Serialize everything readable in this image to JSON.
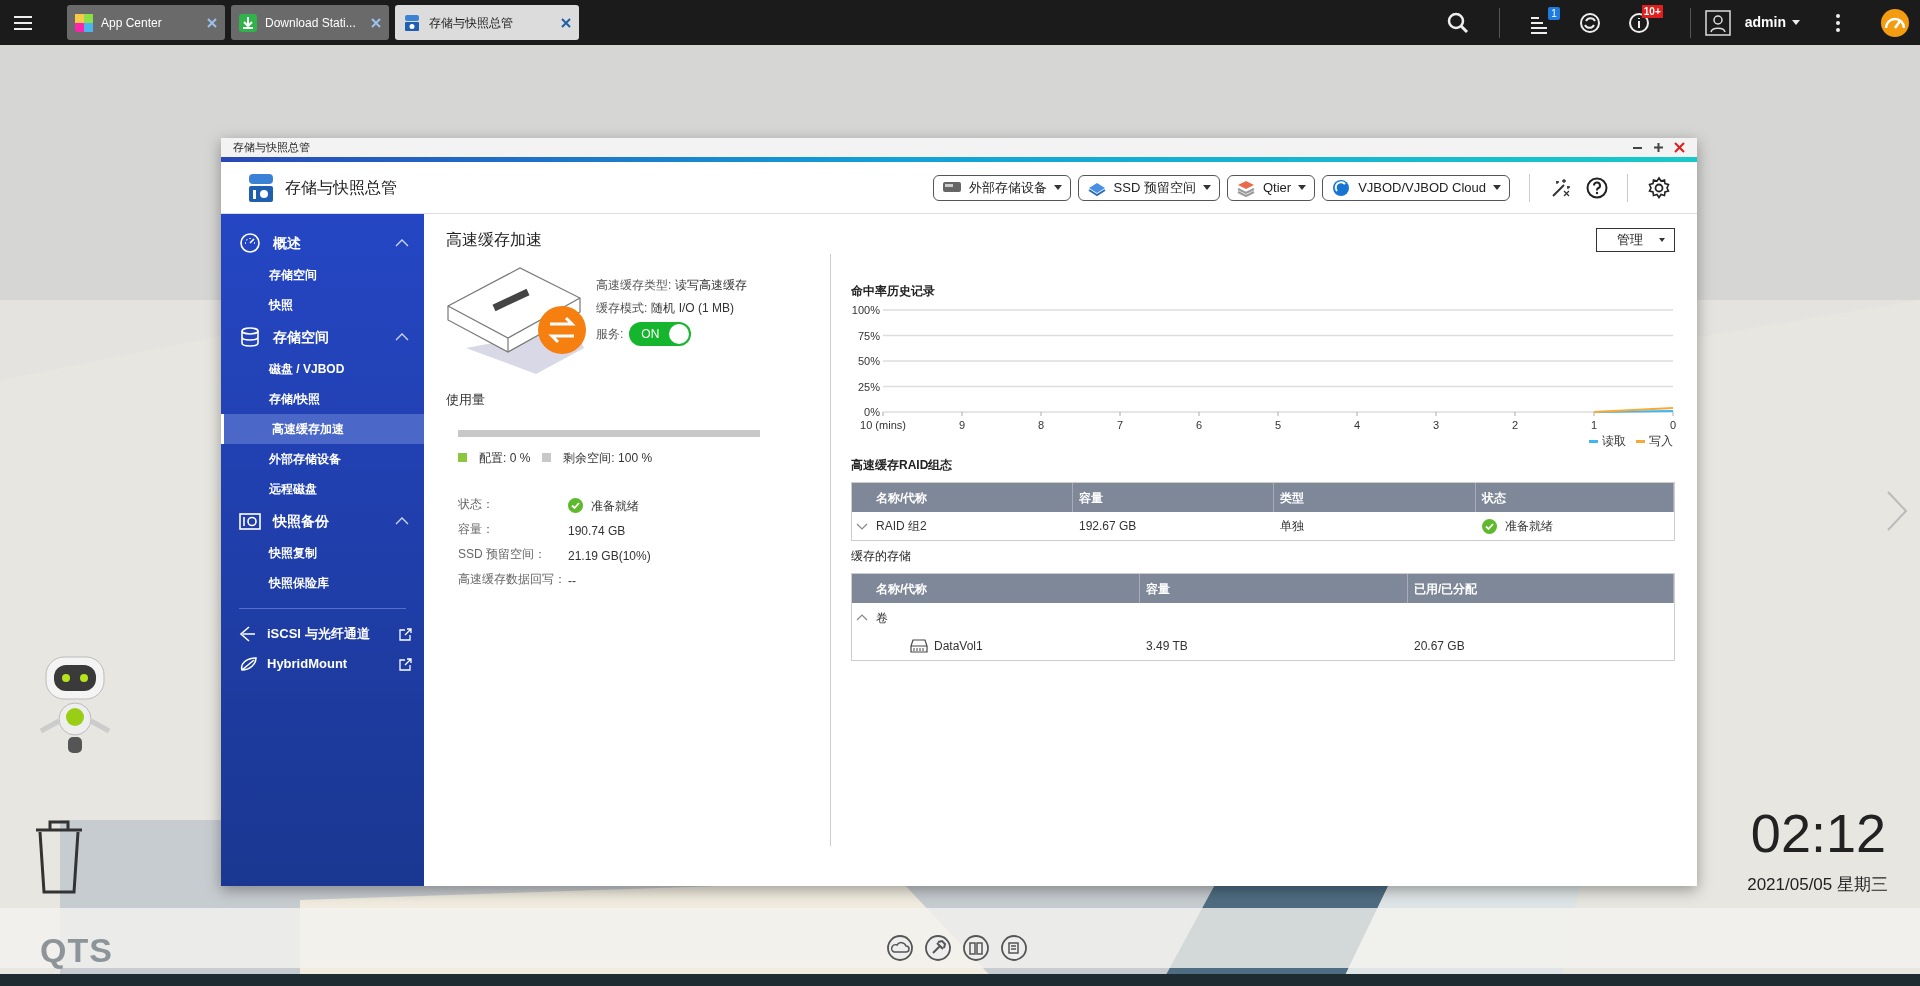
{
  "taskbar": {
    "tabs": [
      {
        "label": "App Center",
        "selected": false
      },
      {
        "label": "Download Stati...",
        "selected": false
      },
      {
        "label": "存储与快照总管",
        "selected": true
      }
    ],
    "badges": [
      "1",
      "10+"
    ],
    "user": "admin"
  },
  "window": {
    "title": "存储与快照总管",
    "app_name": "存储与快照总管",
    "toolbar_buttons": [
      "外部存储设备",
      "SSD 预留空间",
      "Qtier",
      "VJBOD/VJBOD Cloud"
    ]
  },
  "sidebar": {
    "sections": [
      {
        "label": "概述",
        "expanded": true,
        "children": [
          {
            "label": "存储空间",
            "selected": false
          },
          {
            "label": "快照",
            "selected": false
          }
        ]
      },
      {
        "label": "存储空间",
        "expanded": true,
        "children": [
          {
            "label": "磁盘 / VJBOD",
            "selected": false
          },
          {
            "label": "存储/快照",
            "selected": false
          },
          {
            "label": "高速缓存加速",
            "selected": true
          },
          {
            "label": "外部存储设备",
            "selected": false
          },
          {
            "label": "远程磁盘",
            "selected": false
          }
        ]
      },
      {
        "label": "快照备份",
        "expanded": true,
        "children": [
          {
            "label": "快照复制",
            "selected": false
          },
          {
            "label": "快照保险库",
            "selected": false
          }
        ]
      }
    ],
    "links": [
      "iSCSI 与光纤通道",
      "HybridMount"
    ]
  },
  "page": {
    "title": "高速缓存加速",
    "manage_button": "管理",
    "cache": {
      "fields": [
        {
          "label": "高速缓存类型:",
          "value": "读写高速缓存"
        },
        {
          "label": "缓存模式:",
          "value": "随机 I/O (1 MB)"
        }
      ],
      "service": {
        "label": "服务:",
        "on": true,
        "text": "ON"
      }
    },
    "usage": {
      "title": "使用量",
      "level": 0,
      "legend": [
        {
          "label": "配置: 0 %",
          "color": "#8cc63f"
        },
        {
          "label": "剩余空间: 100 %",
          "color": "#c8c8c8"
        }
      ]
    },
    "details": [
      {
        "label": "状态：",
        "value": "准备就绪",
        "kind": "status"
      },
      {
        "label": "容量：",
        "value": "190.74 GB",
        "kind": "text"
      },
      {
        "label": "SSD 预留空间：",
        "value": "21.19 GB(10%)",
        "kind": "text"
      },
      {
        "label": "高速缓存数据回写：",
        "value": "--",
        "kind": "text"
      }
    ],
    "hit_rate": {
      "title": "命中率历史记录",
      "chart_data": {
        "type": "line",
        "categories": [
          "10 (mins)",
          "9",
          "8",
          "7",
          "6",
          "5",
          "4",
          "3",
          "2",
          "1",
          "0"
        ],
        "series": [
          {
            "name": "读取",
            "color": "#3fb6f0",
            "values": [
              null,
              null,
              null,
              null,
              null,
              null,
              null,
              null,
              null,
              0,
              1
            ]
          },
          {
            "name": "写入",
            "color": "#f7a935",
            "values": [
              null,
              null,
              null,
              null,
              null,
              null,
              null,
              null,
              null,
              0,
              4
            ]
          }
        ],
        "ylim": [
          0,
          100
        ],
        "grid": true,
        "yticks": [
          {
            "value": 0,
            "label": "0%"
          },
          {
            "value": 25,
            "label": "25%"
          },
          {
            "value": 50,
            "label": "50%"
          },
          {
            "value": 75,
            "label": "75%"
          },
          {
            "value": 100,
            "label": "100%"
          }
        ]
      }
    },
    "raid": {
      "title": "高速缓存RAID组态",
      "columns": [
        "名称/代称",
        "容量",
        "类型",
        "状态"
      ],
      "rows": [
        {
          "expanded": false,
          "cells": [
            "RAID 组2",
            "192.67 GB",
            "单独",
            "准备就绪"
          ]
        }
      ]
    },
    "storage": {
      "title": "缓存的存储",
      "columns": [
        "名称/代称",
        "容量",
        "已用/已分配"
      ],
      "groups": [
        {
          "label": "卷",
          "expanded": true,
          "children": [
            {
              "cells": [
                "DataVol1",
                "3.49 TB",
                "20.67 GB"
              ]
            }
          ]
        }
      ]
    }
  },
  "desktop": {
    "time": "02:12",
    "date": "2021/05/05 星期三",
    "logo": "QTS"
  }
}
